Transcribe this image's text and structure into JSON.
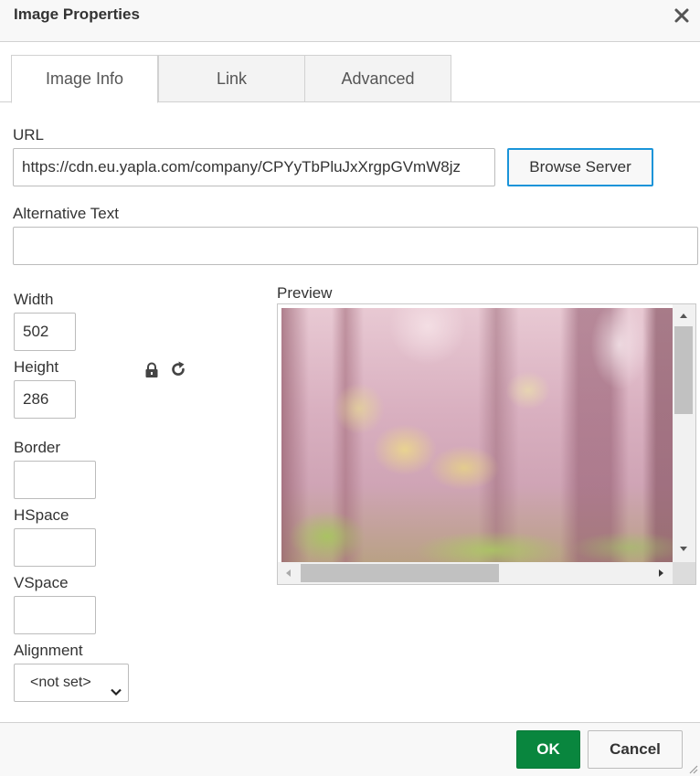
{
  "dialog": {
    "title": "Image Properties",
    "close_icon": "close-icon"
  },
  "tabs": [
    {
      "label": "Image Info",
      "active": true
    },
    {
      "label": "Link",
      "active": false
    },
    {
      "label": "Advanced",
      "active": false
    }
  ],
  "url": {
    "label": "URL",
    "value": "https://cdn.eu.yapla.com/company/CPYyTbPluJxXrgpGVmW8jz",
    "browse_label": "Browse Server"
  },
  "alt_text": {
    "label": "Alternative Text",
    "value": ""
  },
  "dimensions": {
    "width_label": "Width",
    "width_value": "502",
    "height_label": "Height",
    "height_value": "286",
    "lock_icon": "lock-icon",
    "reset_icon": "reset-size-icon"
  },
  "border": {
    "label": "Border",
    "value": ""
  },
  "hspace": {
    "label": "HSpace",
    "value": ""
  },
  "vspace": {
    "label": "VSpace",
    "value": ""
  },
  "alignment": {
    "label": "Alignment",
    "selected": "<not set>"
  },
  "preview": {
    "label": "Preview",
    "image_description_icon": "forest-image"
  },
  "footer": {
    "ok_label": "OK",
    "cancel_label": "Cancel"
  },
  "colors": {
    "accent_blue": "#1a94d9",
    "ok_green": "#09863e"
  }
}
